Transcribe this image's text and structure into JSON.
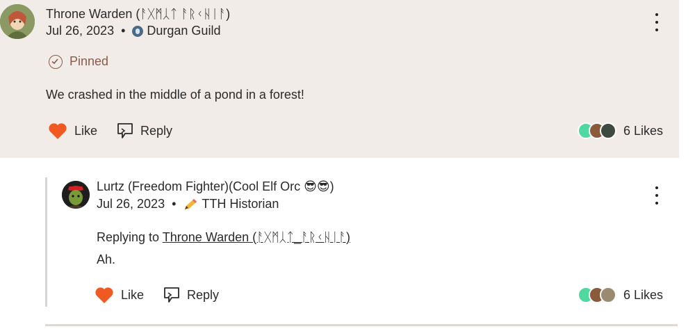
{
  "post": {
    "author": "Throne Warden (ᚨᚷᛗᛸᛏ ᚨᚱᚲᚺᛁᚨ)",
    "date": "Jul 26, 2023",
    "dot": "•",
    "group": "Durgan Guild",
    "pinned": "Pinned",
    "text": "We crashed in the middle of a pond in a forest!",
    "like_label": "Like",
    "reply_label": "Reply",
    "likes": "6 Likes"
  },
  "reply": {
    "author": "Lurtz (Freedom Fighter)(Cool Elf Orc 😎😎)",
    "date": "Jul 26, 2023",
    "dot": "•",
    "badge": "TTH Historian",
    "replying_prefix": "Replying to",
    "replying_to": "Throne Warden (ᚨᚷᛗᛸᛏ_ᚨᚱᚲᚺᛁᚨ)",
    "text": "Ah.",
    "like_label": "Like",
    "reply_label": "Reply",
    "likes": "6 Likes"
  },
  "icons": {
    "heart": "heart-icon",
    "reply": "reply-icon",
    "menu": "more-vertical-icon",
    "pin": "pinned-check-icon",
    "group": "guild-badge-icon",
    "pencil": "pencil-icon"
  },
  "colors": {
    "heart": "#f05a22",
    "post_bg": "#f2ece9",
    "pinned": "#8a5a4a"
  }
}
